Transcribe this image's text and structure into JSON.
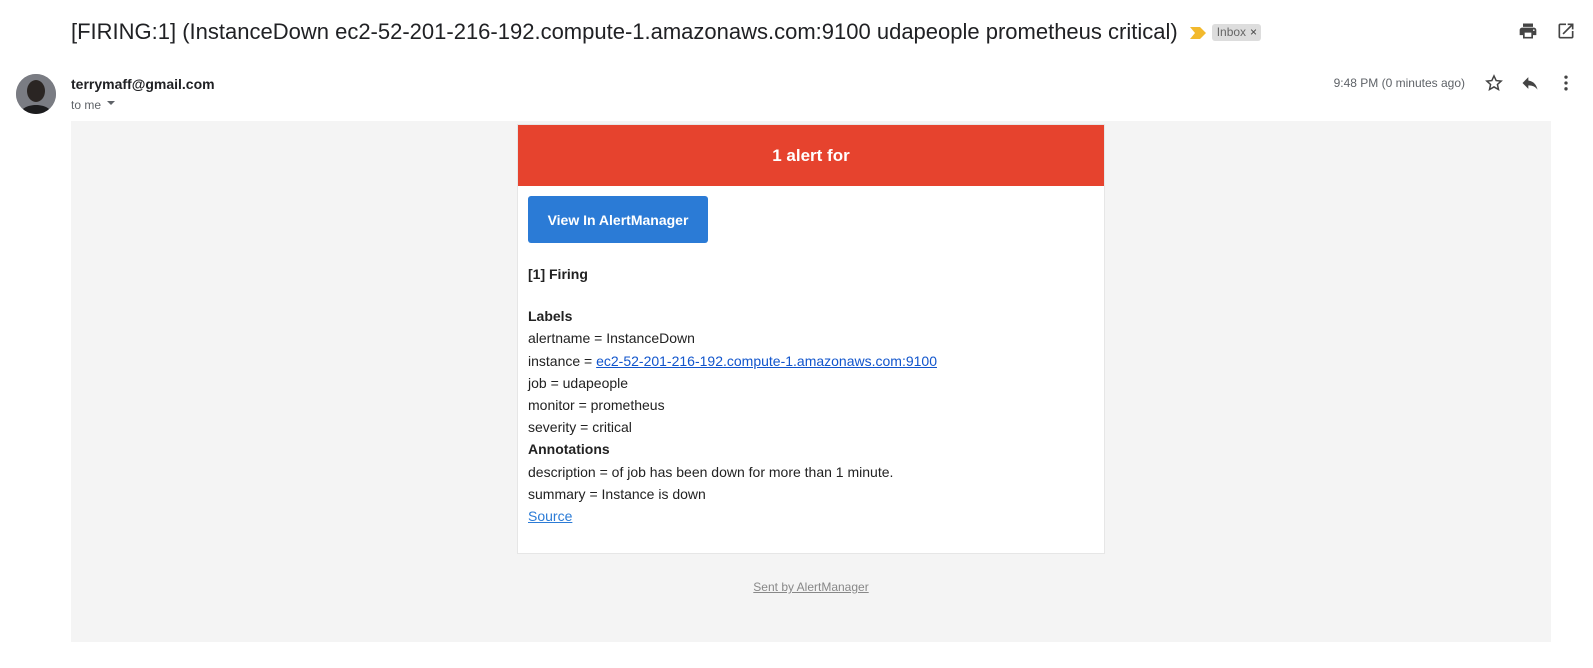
{
  "email": {
    "subject": "[FIRING:1] (InstanceDown ec2-52-201-216-192.compute-1.amazonaws.com:9100 udapeople prometheus critical)",
    "label": "Inbox",
    "label_close": "×",
    "sender": "terrymaff@gmail.com",
    "recipient": "to me",
    "timestamp": "9:48 PM (0 minutes ago)"
  },
  "icons": {
    "importance": "importance-marker-icon",
    "print": "print-icon",
    "open_new_window": "open-in-new-window-icon",
    "recipient_dropdown": "chevron-down-icon",
    "star": "star-icon",
    "reply": "reply-icon",
    "more": "more-vertical-icon"
  },
  "colors": {
    "alert_header": "#e6432e",
    "button": "#2b7bd6",
    "importance": "#f2b92d",
    "link": "#1155cc"
  },
  "alert": {
    "header": "1 alert for",
    "button_label": "View In AlertManager",
    "firing_heading": "[1] Firing",
    "labels_heading": "Labels",
    "labels": {
      "alertname": "alertname = InstanceDown",
      "instance_prefix": "instance = ",
      "instance_link": "ec2-52-201-216-192.compute-1.amazonaws.com:9100",
      "job": "job = udapeople",
      "monitor": "monitor = prometheus",
      "severity": "severity = critical"
    },
    "annotations_heading": "Annotations",
    "annotations": {
      "description": "description = of job has been down for more than 1 minute.",
      "summary": "summary = Instance is down"
    },
    "source_link": "Source"
  },
  "footer": {
    "sent_by": "Sent by AlertManager"
  }
}
